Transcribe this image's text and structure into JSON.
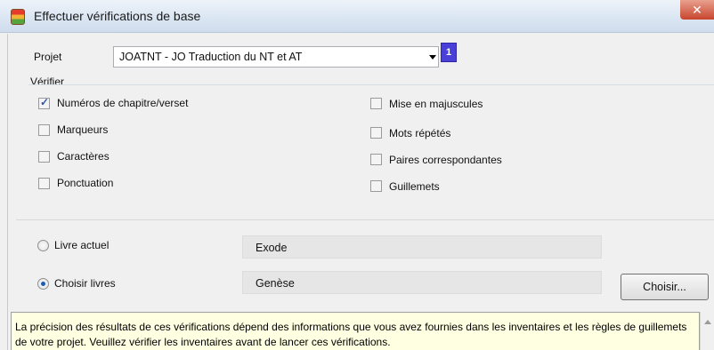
{
  "window": {
    "title": "Effectuer vérifications de base",
    "close_glyph": "✕"
  },
  "project": {
    "label": "Projet",
    "value": "JOATNT   - JO Traduction du NT et AT",
    "badge": "1"
  },
  "verify": {
    "label": "Vérifier",
    "checks": [
      {
        "label": "Numéros de chapitre/verset",
        "checked": true
      },
      {
        "label": "Marqueurs",
        "checked": false
      },
      {
        "label": "Caractères",
        "checked": false
      },
      {
        "label": "Ponctuation",
        "checked": false
      },
      {
        "label": "Mise en majuscules",
        "checked": false
      },
      {
        "label": "Mots répétés",
        "checked": false
      },
      {
        "label": "Paires correspondantes",
        "checked": false
      },
      {
        "label": "Guillemets",
        "checked": false
      }
    ]
  },
  "books": {
    "current": {
      "label": "Livre actuel",
      "value": "Exode",
      "selected": false
    },
    "choose": {
      "label": "Choisir livres",
      "value": "Genèse",
      "selected": true
    },
    "choose_button": "Choisir..."
  },
  "info": "La précision des résultats de ces vérifications dépend des informations que vous avez fournies dans les inventaires et les règles de guillemets de votre projet. Veuillez vérifier les inventaires avant de lancer ces vérifications.",
  "icons": {
    "app": "app-icon",
    "close": "close-icon",
    "dropdown": "chevron-down-icon",
    "scroll_up": "scroll-up-icon"
  }
}
